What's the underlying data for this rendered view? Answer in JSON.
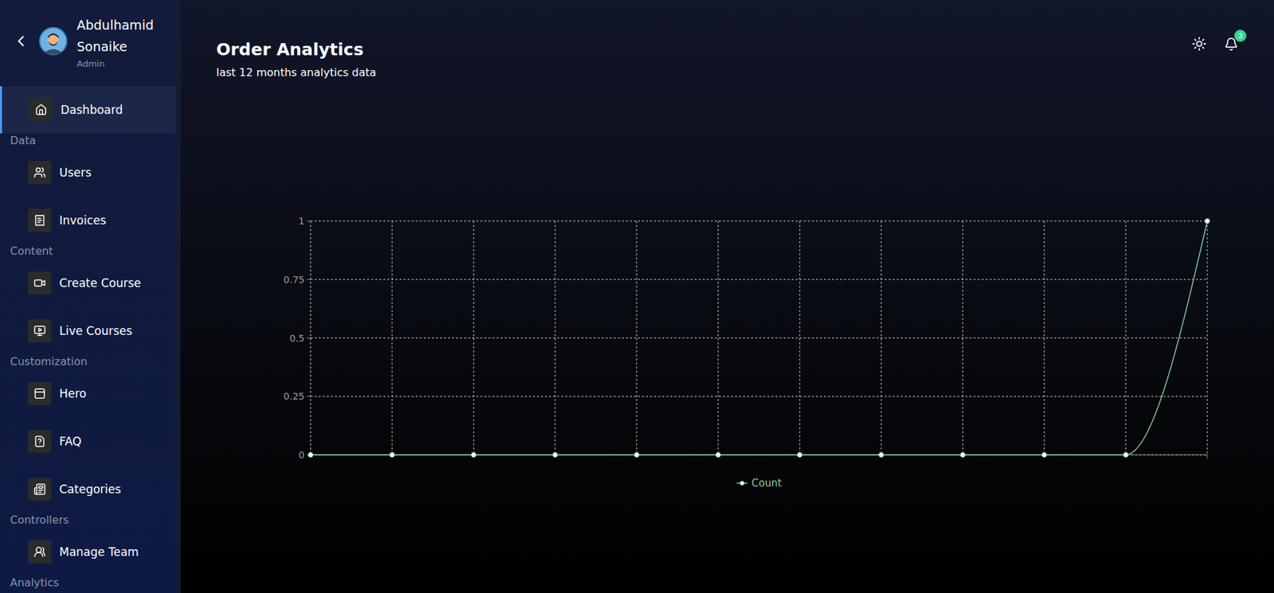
{
  "sidebar": {
    "user": {
      "name": "Abdulhamid Sonaike",
      "role": "Admin"
    },
    "items": [
      {
        "kind": "link",
        "label": "Dashboard",
        "selected": true
      },
      {
        "kind": "heading",
        "label": "Data",
        "selected": false
      },
      {
        "kind": "link",
        "label": "Users",
        "selected": false
      },
      {
        "kind": "link",
        "label": "Invoices",
        "selected": false
      },
      {
        "kind": "heading",
        "label": "Content",
        "selected": false
      },
      {
        "kind": "link",
        "label": "Create Course",
        "selected": false
      },
      {
        "kind": "link",
        "label": "Live Courses",
        "selected": false
      },
      {
        "kind": "heading",
        "label": "Customization",
        "selected": false
      },
      {
        "kind": "link",
        "label": "Hero",
        "selected": false
      },
      {
        "kind": "link",
        "label": "FAQ",
        "selected": false
      },
      {
        "kind": "link",
        "label": "Categories",
        "selected": false
      },
      {
        "kind": "heading",
        "label": "Controllers",
        "selected": false
      },
      {
        "kind": "link",
        "label": "Manage Team",
        "selected": false
      },
      {
        "kind": "heading",
        "label": "Analytics",
        "selected": false
      }
    ]
  },
  "header": {
    "notifications": "3"
  },
  "page": {
    "title": "Order Analytics",
    "subtitle": "last 12 months analytics data"
  },
  "chart": {
    "y_ticks": [
      "0",
      "0.25",
      "0.5",
      "0.75",
      "1"
    ],
    "y_max": 1,
    "series": [
      {
        "name": "Count",
        "color": "#82ca9d",
        "values": [
          0,
          0,
          0,
          0,
          0,
          0,
          0,
          0,
          0,
          0,
          0,
          1
        ]
      }
    ]
  }
}
